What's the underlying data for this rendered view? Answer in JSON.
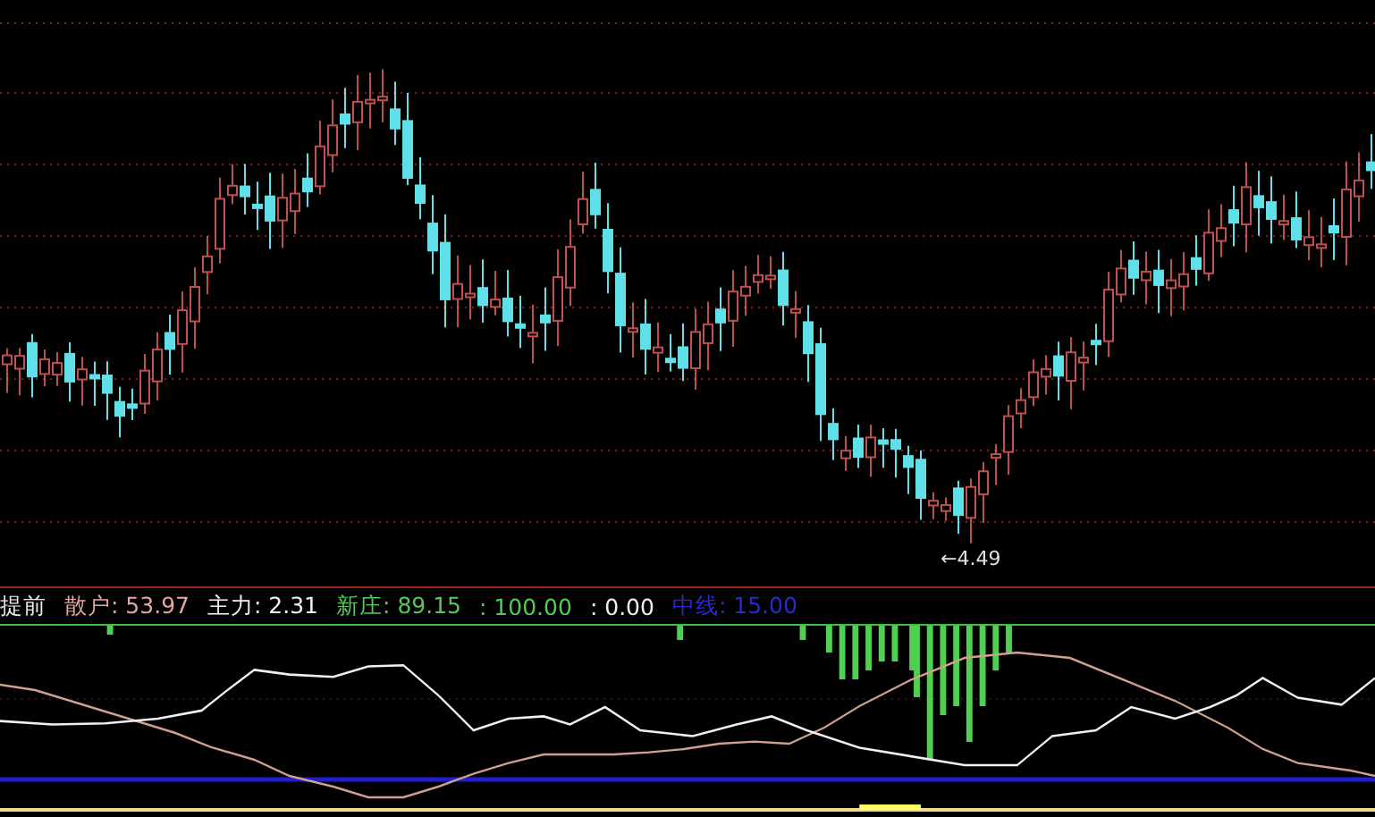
{
  "price_chart": {
    "low_marker": "←4.49"
  },
  "indicator_legend": [
    {
      "text": "提前",
      "color": "#e8e8e8"
    },
    {
      "text": "散户: 53.97",
      "color": "#e0a8a0"
    },
    {
      "text": "主力: 2.31",
      "color": "#f0f0f0"
    },
    {
      "text": "新庄: 89.15",
      "color": "#58c858"
    },
    {
      "text": ": 100.00",
      "color": "#58c858"
    },
    {
      "text": ": 0.00",
      "color": "#f0f0f0"
    },
    {
      "text": "中线: 15.00",
      "color": "#2a2ad0"
    }
  ]
}
